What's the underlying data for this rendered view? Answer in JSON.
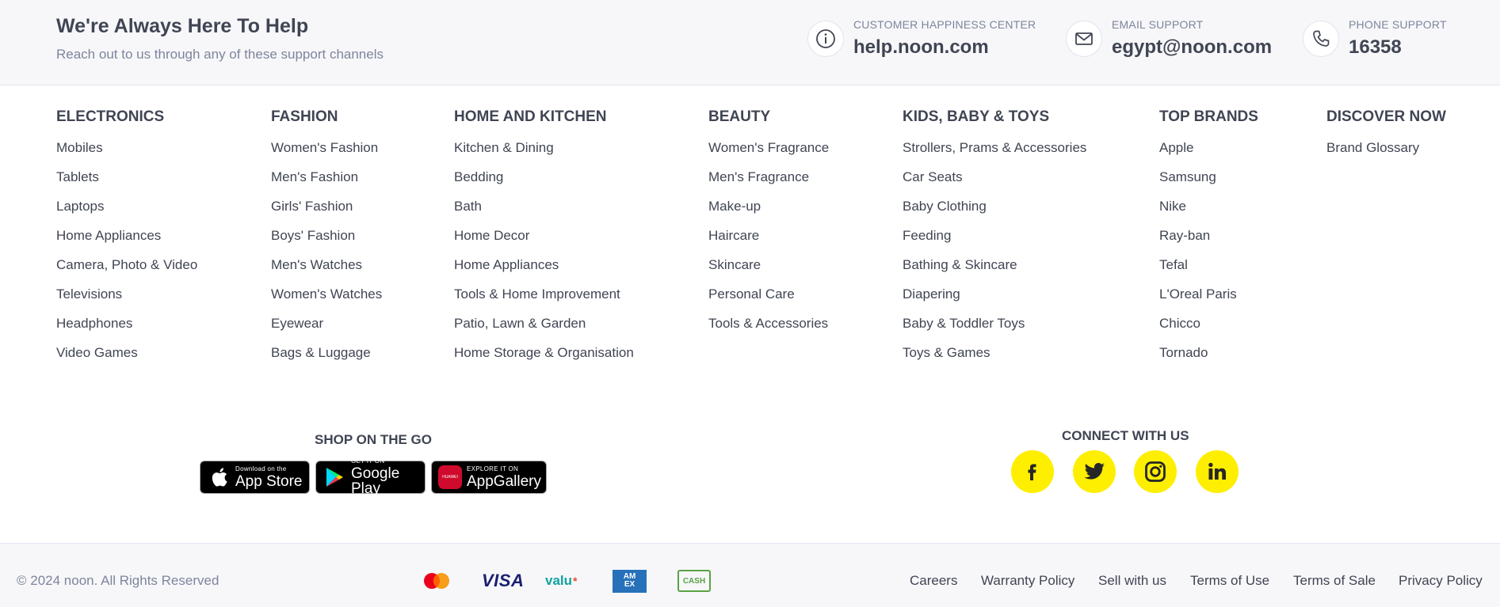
{
  "support": {
    "title": "We're Always Here To Help",
    "subtitle": "Reach out to us through any of these support channels",
    "channels": [
      {
        "label": "CUSTOMER HAPPINESS CENTER",
        "value": "help.noon.com",
        "icon": "info-icon"
      },
      {
        "label": "EMAIL SUPPORT",
        "value": "egypt@noon.com",
        "icon": "mail-icon"
      },
      {
        "label": "PHONE SUPPORT",
        "value": "16358",
        "icon": "phone-icon"
      }
    ]
  },
  "columns": [
    {
      "heading": "ELECTRONICS",
      "links": [
        "Mobiles",
        "Tablets",
        "Laptops",
        "Home Appliances",
        "Camera, Photo & Video",
        "Televisions",
        "Headphones",
        "Video Games"
      ]
    },
    {
      "heading": "FASHION",
      "links": [
        "Women's Fashion",
        "Men's Fashion",
        "Girls' Fashion",
        "Boys' Fashion",
        "Men's Watches",
        "Women's Watches",
        "Eyewear",
        "Bags & Luggage"
      ]
    },
    {
      "heading": "HOME AND KITCHEN",
      "links": [
        "Kitchen & Dining",
        "Bedding",
        "Bath",
        "Home Decor",
        "Home Appliances",
        "Tools & Home Improvement",
        "Patio, Lawn & Garden",
        "Home Storage & Organisation"
      ]
    },
    {
      "heading": "BEAUTY",
      "links": [
        "Women's Fragrance",
        "Men's Fragrance",
        "Make-up",
        "Haircare",
        "Skincare",
        "Personal Care",
        "Tools & Accessories"
      ]
    },
    {
      "heading": "KIDS, BABY & TOYS",
      "links": [
        "Strollers, Prams & Accessories",
        "Car Seats",
        "Baby Clothing",
        "Feeding",
        "Bathing & Skincare",
        "Diapering",
        "Baby & Toddler Toys",
        "Toys & Games"
      ]
    },
    {
      "heading": "TOP BRANDS",
      "links": [
        "Apple",
        "Samsung",
        "Nike",
        "Ray-ban",
        "Tefal",
        "L'Oreal Paris",
        "Chicco",
        "Tornado"
      ]
    },
    {
      "heading": "DISCOVER NOW",
      "links": [
        "Brand Glossary"
      ]
    }
  ],
  "apps": {
    "heading": "SHOP ON THE GO",
    "badges": [
      {
        "small": "Download on the",
        "big": "App Store",
        "icon": "apple-icon"
      },
      {
        "small": "GET IT ON",
        "big": "Google Play",
        "icon": "google-play-icon"
      },
      {
        "small": "EXPLORE IT ON",
        "big": "AppGallery",
        "icon": "huawei-appgallery-icon",
        "icon_text": "HUAWEI"
      }
    ]
  },
  "social": {
    "heading": "CONNECT WITH US",
    "accent": "#feee00",
    "items": [
      "facebook-icon",
      "twitter-icon",
      "instagram-icon",
      "linkedin-icon"
    ]
  },
  "bottom": {
    "copyright": "© 2024 noon. All Rights Reserved",
    "payments": {
      "mastercard": "mastercard-icon",
      "visa": "VISA",
      "valu": "valu",
      "amex": "AM EX",
      "cash": "CASH"
    },
    "links": [
      "Careers",
      "Warranty Policy",
      "Sell with us",
      "Terms of Use",
      "Terms of Sale",
      "Privacy Policy"
    ]
  }
}
